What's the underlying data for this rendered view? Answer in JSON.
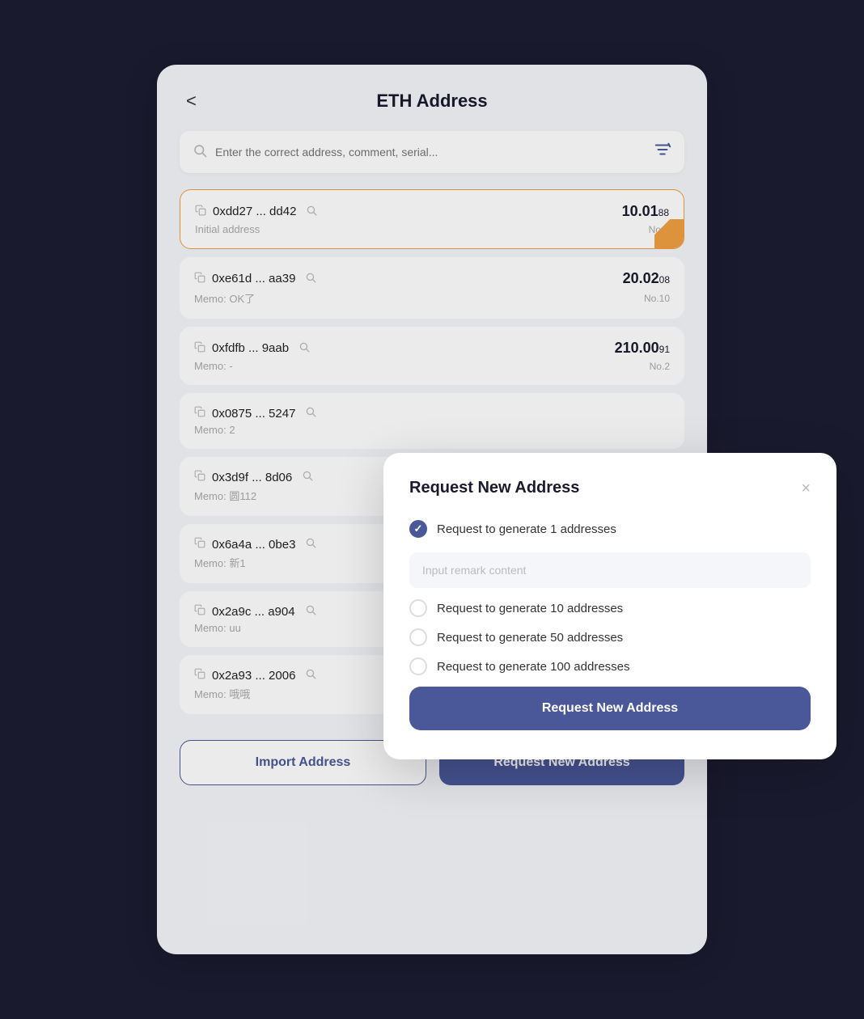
{
  "header": {
    "title": "ETH Address",
    "back_label": "<"
  },
  "search": {
    "placeholder": "Enter the correct address, comment, serial..."
  },
  "addresses": [
    {
      "address": "0xdd27 ... dd42",
      "memo": "Initial address",
      "amount_main": "10.01",
      "amount_small": "88",
      "no": "No.0",
      "active": true
    },
    {
      "address": "0xe61d ... aa39",
      "memo": "Memo: OK了",
      "amount_main": "20.02",
      "amount_small": "08",
      "no": "No.10",
      "active": false
    },
    {
      "address": "0xfdfb ... 9aab",
      "memo": "Memo: -",
      "amount_main": "210.00",
      "amount_small": "91",
      "no": "No.2",
      "active": false
    },
    {
      "address": "0x0875 ... 5247",
      "memo": "Memo: 2",
      "amount_main": "",
      "amount_small": "",
      "no": "",
      "active": false
    },
    {
      "address": "0x3d9f ... 8d06",
      "memo": "Memo: 圆112",
      "amount_main": "",
      "amount_small": "",
      "no": "",
      "active": false
    },
    {
      "address": "0x6a4a ... 0be3",
      "memo": "Memo: 新1",
      "amount_main": "",
      "amount_small": "",
      "no": "",
      "active": false
    },
    {
      "address": "0x2a9c ... a904",
      "memo": "Memo: uu",
      "amount_main": "",
      "amount_small": "",
      "no": "",
      "active": false
    },
    {
      "address": "0x2a93 ... 2006",
      "memo": "Memo: 哦哦",
      "amount_main": "",
      "amount_small": "",
      "no": "",
      "active": false
    }
  ],
  "buttons": {
    "import": "Import Address",
    "request": "Request New Address"
  },
  "modal": {
    "title": "Request New Address",
    "close_label": "×",
    "remark_placeholder": "Input remark content",
    "options": [
      {
        "label": "Request to generate 1 addresses",
        "checked": true
      },
      {
        "label": "Request to generate 10 addresses",
        "checked": false
      },
      {
        "label": "Request to generate 50 addresses",
        "checked": false
      },
      {
        "label": "Request to generate 100 addresses",
        "checked": false
      }
    ],
    "confirm_label": "Request New Address"
  }
}
